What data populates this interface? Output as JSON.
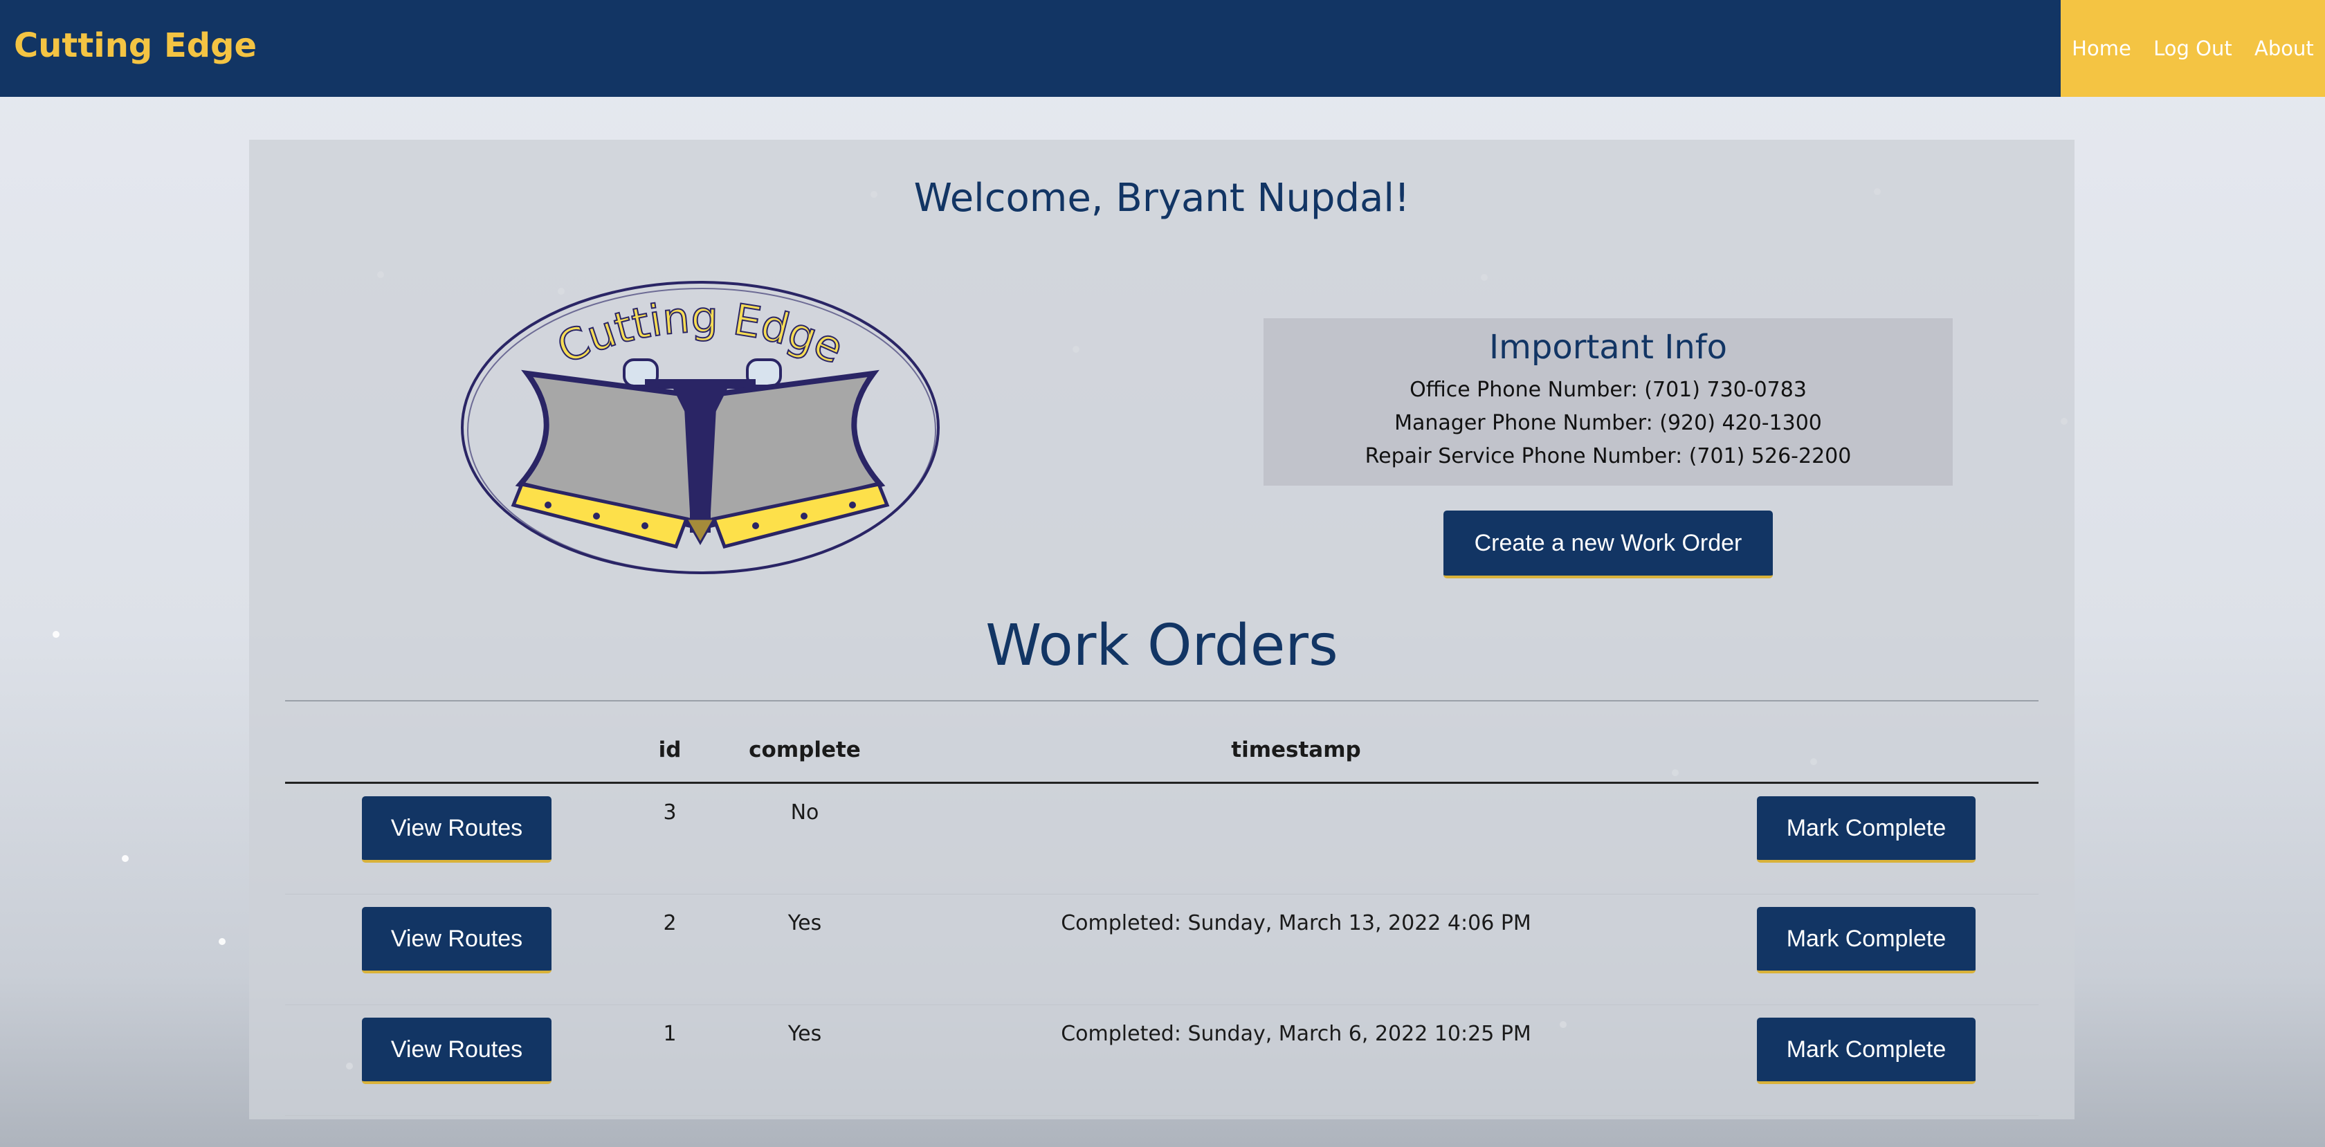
{
  "navbar": {
    "brand": "Cutting Edge",
    "links": [
      "Home",
      "Log Out",
      "About"
    ]
  },
  "main": {
    "welcome": "Welcome, Bryant Nupdal!",
    "logo_text": "Cutting Edge",
    "info": {
      "title": "Important Info",
      "lines": [
        "Office Phone Number: (701) 730-0783",
        "Manager Phone Number: (920) 420-1300",
        "Repair Service Phone Number: (701) 526-2200"
      ]
    },
    "create_button": "Create a new Work Order",
    "work_orders_title": "Work Orders",
    "table": {
      "headers": [
        "",
        "id",
        "complete",
        "timestamp",
        ""
      ],
      "rows": [
        {
          "view": "View Routes",
          "id": "3",
          "complete": "No",
          "timestamp": "",
          "action": "Mark Complete"
        },
        {
          "view": "View Routes",
          "id": "2",
          "complete": "Yes",
          "timestamp": "Completed: Sunday, March 13, 2022 4:06 PM",
          "action": "Mark Complete"
        },
        {
          "view": "View Routes",
          "id": "1",
          "complete": "Yes",
          "timestamp": "Completed: Sunday, March 6, 2022 10:25 PM",
          "action": "Mark Complete"
        }
      ]
    }
  },
  "colors": {
    "navy": "#123564",
    "gold": "#f4c443"
  }
}
